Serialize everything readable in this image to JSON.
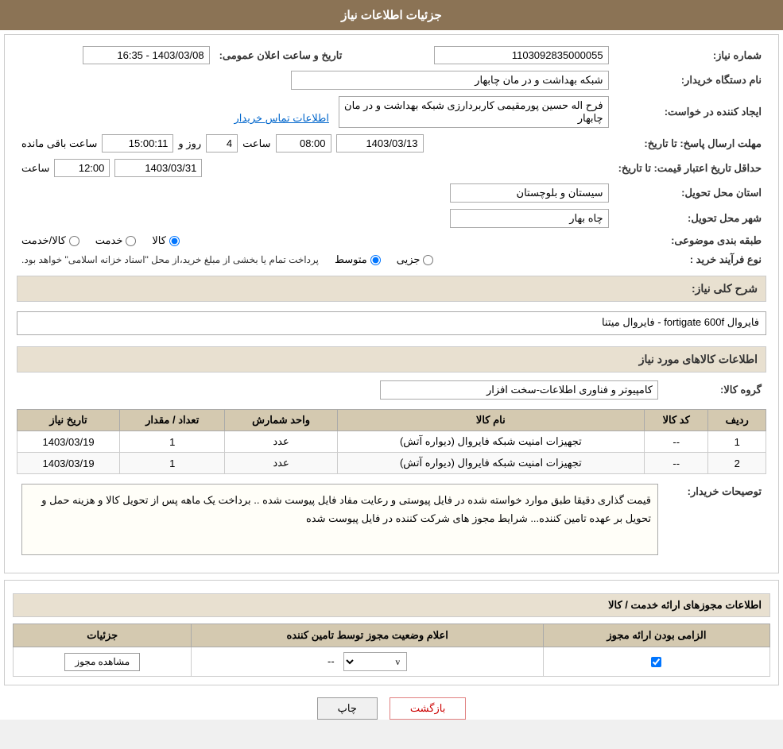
{
  "header": {
    "title": "جزئیات اطلاعات نیاز"
  },
  "fields": {
    "need_number_label": "شماره نیاز:",
    "need_number_value": "1103092835000055",
    "buyer_station_label": "نام دستگاه خریدار:",
    "buyer_station_value": "شبکه بهداشت و در مان چابهار",
    "creator_label": "ایجاد کننده در خواست:",
    "creator_value": "فرح اله حسین پورمقیمی کاربردارزی شبکه بهداشت و در مان چابهار",
    "contact_info_link": "اطلاعات تماس خریدار",
    "send_deadline_label": "مهلت ارسال پاسخ: تا تاریخ:",
    "send_date": "1403/03/13",
    "send_time_label": "ساعت",
    "send_time": "08:00",
    "send_days_label": "روز و",
    "send_days": "4",
    "remaining_label": "ساعت باقی مانده",
    "remaining_time": "15:00:11",
    "price_validity_label": "حداقل تاریخ اعتبار قیمت: تا تاریخ:",
    "price_validity_date": "1403/03/31",
    "price_validity_time_label": "ساعت",
    "price_validity_time": "12:00",
    "announce_label": "تاریخ و ساعت اعلان عمومی:",
    "announce_value": "1403/03/08 - 16:35",
    "province_label": "استان محل تحویل:",
    "province_value": "سیستان و بلوچستان",
    "city_label": "شهر محل تحویل:",
    "city_value": "چاه بهار",
    "category_label": "طبقه بندی موضوعی:",
    "category_options": [
      "کالا",
      "خدمت",
      "کالا/خدمت"
    ],
    "category_selected": "کالا",
    "process_label": "نوع فرآیند خرید :",
    "process_options": [
      "جزیی",
      "متوسط"
    ],
    "process_selected": "متوسط",
    "process_description": "پرداخت تمام یا بخشی از مبلغ خرید،از محل \"اسناد خزانه اسلامی\" خواهد بود."
  },
  "need_summary": {
    "label": "شرح کلی نیاز:",
    "value": "فایروال fortigate 600f - فایروال میتنا"
  },
  "goods_section": {
    "title": "اطلاعات کالاهای مورد نیاز",
    "group_label": "گروه کالا:",
    "group_value": "کامپیوتر و فناوری اطلاعات-سخت افزار",
    "table": {
      "headers": [
        "ردیف",
        "کد کالا",
        "نام کالا",
        "واحد شمارش",
        "تعداد / مقدار",
        "تاریخ نیاز"
      ],
      "rows": [
        {
          "row": "1",
          "code": "--",
          "name": "تجهیزات امنیت شبکه فایروال (دیواره آتش)",
          "unit": "عدد",
          "qty": "1",
          "date": "1403/03/19"
        },
        {
          "row": "2",
          "code": "--",
          "name": "تجهیزات امنیت شبکه فایروال (دیواره آتش)",
          "unit": "عدد",
          "qty": "1",
          "date": "1403/03/19"
        }
      ]
    }
  },
  "buyer_notes": {
    "label": "توصیحات خریدار:",
    "value": "قیمت گذاری دقیقا طبق موارد خواسته شده در فایل پیوستی و رعایت مفاد فایل پیوست شده .. برداخت یک ماهه پس از تحویل کالا و هزینه حمل و تحویل بر عهده تامین کننده... شرایط مجوز های شرکت کننده در فایل پیوست شده"
  },
  "permits_section": {
    "title": "اطلاعات مجوزهای ارائه خدمت / کالا",
    "table": {
      "headers": [
        "الزامی بودن ارائه مجوز",
        "اعلام وضعیت مجوز توسط تامین کننده",
        "جزئیات"
      ],
      "rows": [
        {
          "required": true,
          "status_options": [
            "",
            "v"
          ],
          "status_selected": "v",
          "detail_value": "--",
          "view_btn": "مشاهده مجوز"
        }
      ]
    }
  },
  "buttons": {
    "print": "چاپ",
    "back": "بازگشت"
  }
}
